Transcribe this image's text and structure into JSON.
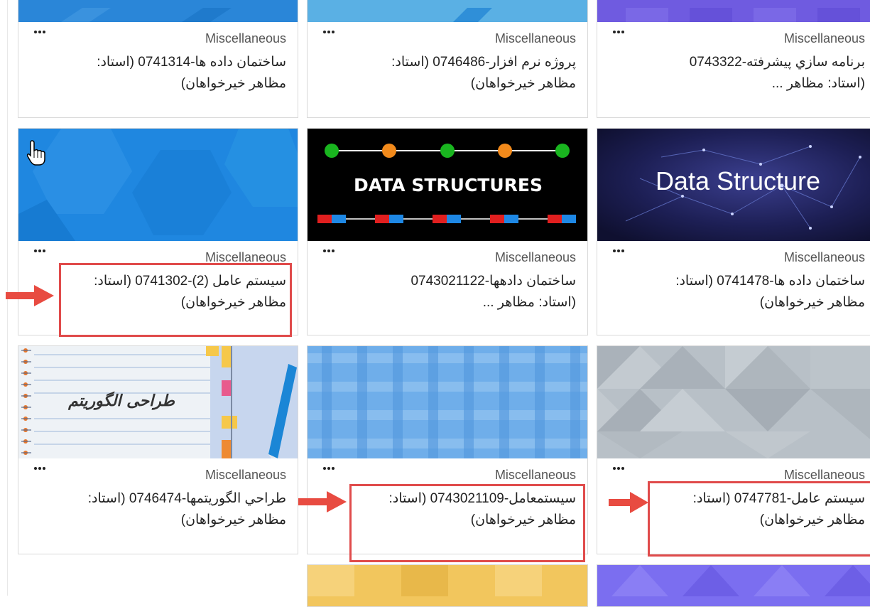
{
  "colors": {
    "highlight": "#e04b4b",
    "card_border": "#d9d9d9",
    "category_text": "#555555"
  },
  "cards": [
    {
      "category": "Miscellaneous",
      "title_line1": "برنامه سازي پيشرفته-0743322",
      "title_line2": "(استاد: مظاهر ...",
      "image": "purple-geometric-pattern"
    },
    {
      "category": "Miscellaneous",
      "title_line1": "پروژه نرم افزار-0746486 (استاد:",
      "title_line2": "مظاهر خيرخواهان)",
      "image": "light-blue-pattern"
    },
    {
      "category": "Miscellaneous",
      "title_line1": "ساختمان داده ها-0741314 (استاد:",
      "title_line2": "مظاهر خيرخواهان)",
      "image": "blue-pattern"
    },
    {
      "category": "Miscellaneous",
      "title_line1": "ساختمان داده ها-0741478 (استاد:",
      "title_line2": "مظاهر خيرخواهان)",
      "image": "data-structure-network",
      "image_text": "Data Structure"
    },
    {
      "category": "Miscellaneous",
      "title_line1": "ساختمان دادهها-0743021122",
      "title_line2": "(استاد: مظاهر ...",
      "image": "data-structures-nodes",
      "image_text": "DATA STRUCTURES"
    },
    {
      "category": "Miscellaneous",
      "title_line1": "سيستم عامل (2)-0741302 (استاد:",
      "title_line2": "مظاهر خيرخواهان)",
      "image": "blue-hexagon-pattern"
    },
    {
      "category": "Miscellaneous",
      "title_line1": "سيستم عامل-0747781 (استاد:",
      "title_line2": "مظاهر خيرخواهان)",
      "image": "gray-triangle-pattern"
    },
    {
      "category": "Miscellaneous",
      "title_line1": "سيستمعامل-0743021109 (استاد:",
      "title_line2": "مظاهر خيرخواهان)",
      "image": "blue-plaid-pattern"
    },
    {
      "category": "Miscellaneous",
      "title_line1": "طراحي الگوريتمها-0746474 (استاد:",
      "title_line2": "مظاهر خيرخواهان)",
      "image": "notebook-algorithm-design",
      "image_text": "طراحی الگوریتم"
    }
  ]
}
